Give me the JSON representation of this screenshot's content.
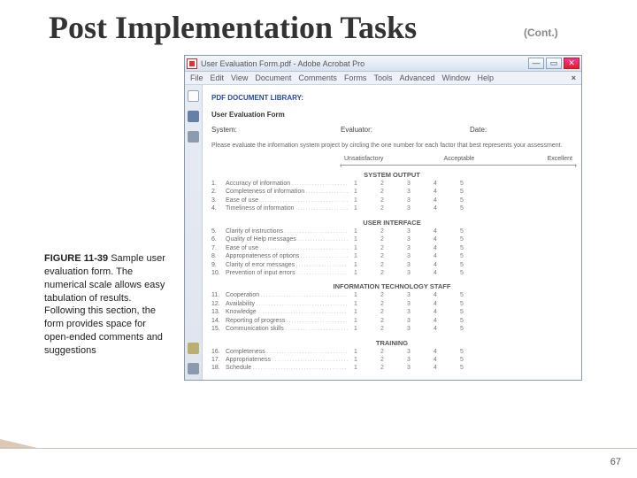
{
  "slide": {
    "title": "Post Implementation Tasks",
    "cont": "(Cont.)",
    "page_number": "67"
  },
  "caption": {
    "figure_label": "FIGURE 11-39",
    "text": " Sample user evaluation form. The numerical scale allows easy tabulation of results. Following this section, the form provides space for open-ended comments and suggestions"
  },
  "acrobat": {
    "window_title": "User Evaluation Form.pdf - Adobe Acrobat Pro",
    "menus": [
      "File",
      "Edit",
      "View",
      "Document",
      "Comments",
      "Forms",
      "Tools",
      "Advanced",
      "Window",
      "Help"
    ],
    "doc": {
      "library": "PDF DOCUMENT LIBRARY:",
      "form_title": "User Evaluation Form",
      "fields": {
        "system": "System:",
        "evaluator": "Evaluator:",
        "date": "Date:"
      },
      "instructions": "Please evaluate the information system project by circling the one number for each factor that best represents your assessment.",
      "legend": {
        "low": "Unsatisfactory",
        "mid": "Acceptable",
        "high": "Excellent"
      },
      "scale": [
        "1",
        "2",
        "3",
        "4",
        "5"
      ],
      "sections": [
        {
          "title": "SYSTEM OUTPUT",
          "items": [
            {
              "n": "1.",
              "t": "Accuracy of information"
            },
            {
              "n": "2.",
              "t": "Completeness of information"
            },
            {
              "n": "3.",
              "t": "Ease of use"
            },
            {
              "n": "4.",
              "t": "Timeliness of information"
            }
          ]
        },
        {
          "title": "USER INTERFACE",
          "items": [
            {
              "n": "5.",
              "t": "Clarity of instructions"
            },
            {
              "n": "6.",
              "t": "Quality of Help messages"
            },
            {
              "n": "7.",
              "t": "Ease of use"
            },
            {
              "n": "8.",
              "t": "Appropriateness of options"
            },
            {
              "n": "9.",
              "t": "Clarity of error messages"
            },
            {
              "n": "10.",
              "t": "Prevention of input errors"
            }
          ]
        },
        {
          "title": "INFORMATION TECHNOLOGY STAFF",
          "items": [
            {
              "n": "11.",
              "t": "Cooperation"
            },
            {
              "n": "12.",
              "t": "Availability"
            },
            {
              "n": "13.",
              "t": "Knowledge"
            },
            {
              "n": "14.",
              "t": "Reporting of progress"
            },
            {
              "n": "15.",
              "t": "Communication skills"
            }
          ]
        },
        {
          "title": "TRAINING",
          "items": [
            {
              "n": "16.",
              "t": "Completeness"
            },
            {
              "n": "17.",
              "t": "Appropriateness"
            },
            {
              "n": "18.",
              "t": "Schedule"
            }
          ]
        }
      ]
    }
  }
}
